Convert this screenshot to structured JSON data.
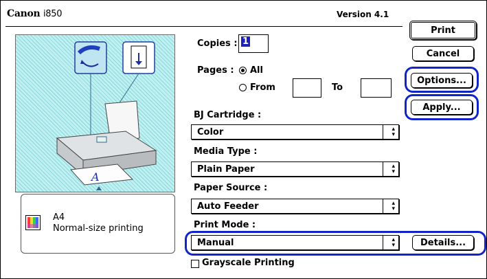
{
  "dialog": {
    "brand": "Canon",
    "model": "i850",
    "version": "Version 4.1"
  },
  "buttons": {
    "print": "Print",
    "cancel": "Cancel",
    "options": "Options...",
    "apply": "Apply...",
    "details": "Details..."
  },
  "copies": {
    "label": "Copies :",
    "value": "1"
  },
  "pages": {
    "label": "Pages :",
    "all_label": "All",
    "from_label": "From",
    "to_label": "To",
    "from_value": "",
    "to_value": "",
    "selected": "All"
  },
  "bj_cartridge": {
    "label": "BJ Cartridge :",
    "value": "Color"
  },
  "media_type": {
    "label": "Media Type :",
    "value": "Plain Paper"
  },
  "paper_source": {
    "label": "Paper Source :",
    "value": "Auto Feeder"
  },
  "print_mode": {
    "label": "Print Mode :",
    "value": "Manual"
  },
  "grayscale": {
    "label": "Grayscale Printing",
    "checked": false
  },
  "info": {
    "paper_size": "A4",
    "description": "Normal-size printing"
  },
  "colors": {
    "highlight": "#1024c8",
    "preview_bg": "#bff0f2",
    "selection": "#1e22b8"
  },
  "icons": {
    "print_mode": "print-quality-icon",
    "paper": "paper-feed-icon",
    "printer": "printer-icon",
    "color_swatch": "color-swatch-icon",
    "popup_arrow": "up-down-arrow-icon"
  }
}
